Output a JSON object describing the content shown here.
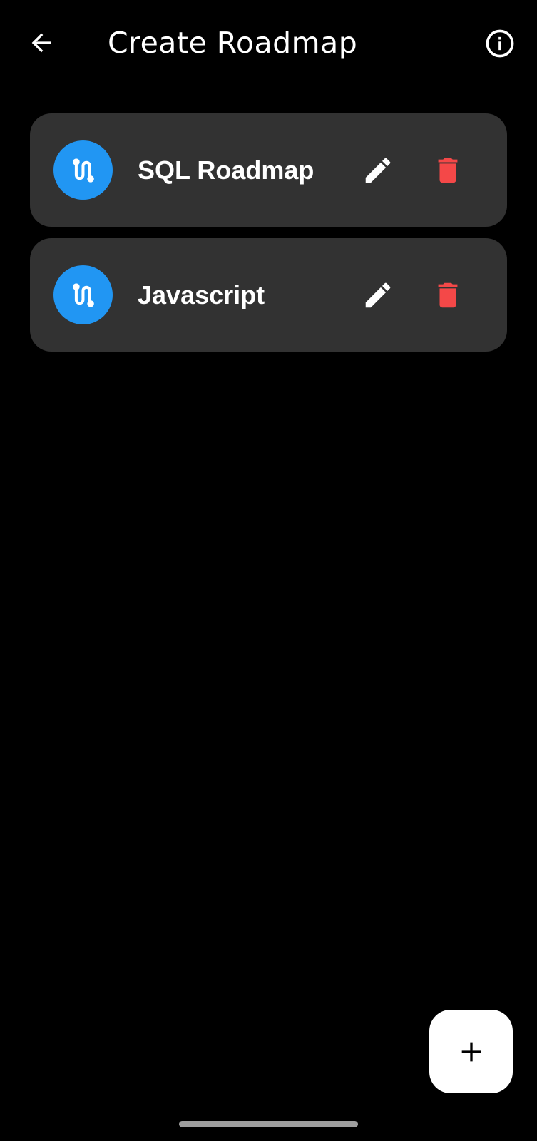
{
  "app_bar": {
    "title": "Create Roadmap",
    "back_icon": "arrow-back-icon",
    "info_icon": "info-outline-icon"
  },
  "roadmaps": [
    {
      "name": "SQL Roadmap",
      "icon": "route-icon"
    },
    {
      "name": "Javascript",
      "icon": "route-icon"
    }
  ],
  "actions": {
    "edit_icon": "pencil-icon",
    "delete_icon": "trash-icon"
  },
  "fab": {
    "icon": "plus-icon"
  },
  "colors": {
    "background": "#000000",
    "card": "#323232",
    "accent": "#2196f3",
    "delete": "#f44848",
    "text": "#ffffff"
  }
}
